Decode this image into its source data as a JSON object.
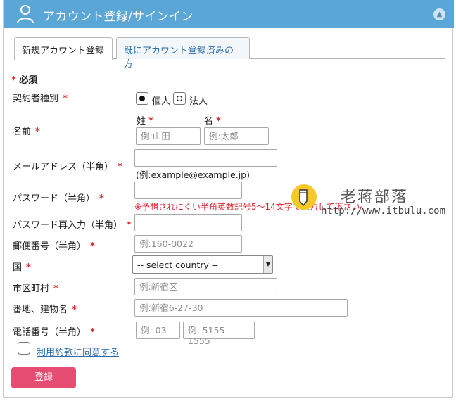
{
  "header": {
    "title": "アカウント登録/サインイン",
    "user_icon": "user-icon",
    "collapse_icon": "chevron-up-icon"
  },
  "tabs": [
    {
      "label": "新規アカウント登録",
      "active": true
    },
    {
      "label": "既にアカウント登録済みの方",
      "active": false
    }
  ],
  "required_note": "必須",
  "required_mark": "*",
  "form": {
    "contract_type": {
      "label": "契約者種別",
      "options": [
        {
          "label": "個人",
          "selected": true
        },
        {
          "label": "法人",
          "selected": false
        }
      ]
    },
    "name": {
      "label": "名前",
      "last_label": "姓",
      "first_label": "名",
      "last_placeholder": "例:山田",
      "first_placeholder": "例:太郎"
    },
    "email": {
      "label": "メールアドレス（半角）",
      "hint": "(例:example@example.jp)"
    },
    "password": {
      "label": "パスワード（半角）",
      "hint": "※予想されにくい半角英数記号5〜14文字で入力して下さい。"
    },
    "password_confirm": {
      "label": "パスワード再入力（半角）"
    },
    "postal_code": {
      "label": "郵便番号（半角）",
      "placeholder": "例:160-0022"
    },
    "country": {
      "label": "国",
      "selected": "-- select country --"
    },
    "city": {
      "label": "市区町村",
      "placeholder": "例:新宿区"
    },
    "address": {
      "label": "番地、建物名",
      "placeholder": "例:新宿6-27-30"
    },
    "phone": {
      "label": "電話番号（半角）",
      "area_placeholder": "例: 03",
      "number_placeholder": "例: 5155-1555"
    },
    "terms": {
      "label": "利用約款に同意する",
      "checked": false
    },
    "submit_label": "登録"
  },
  "watermark": {
    "text": "老蒋部落",
    "url": "http://www.itbulu.com"
  },
  "colors": {
    "header_bg": "#5aa6d6",
    "required": "#e0242e",
    "link": "#2a6db0",
    "submit_bg": "#e74c72"
  }
}
